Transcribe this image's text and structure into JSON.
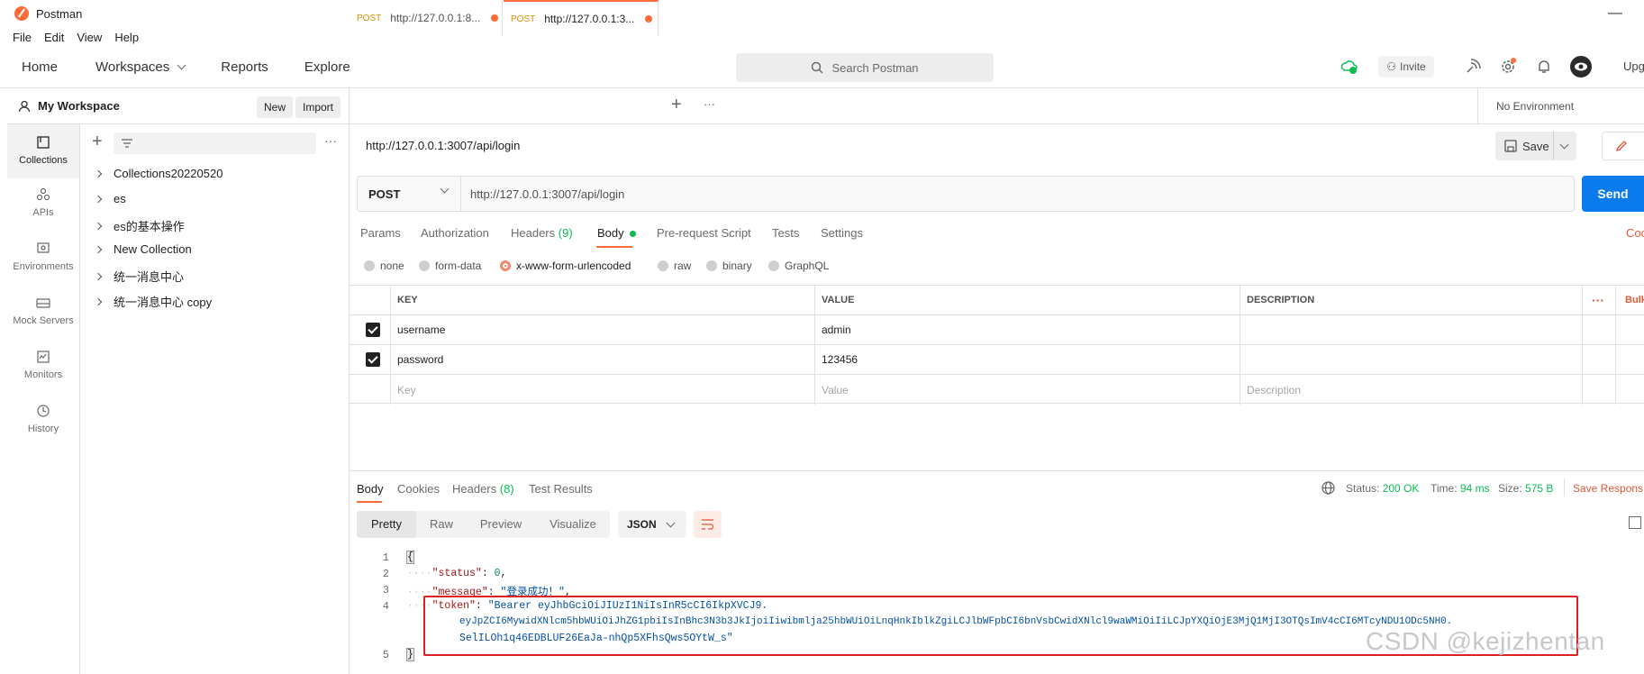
{
  "window": {
    "title": "Postman"
  },
  "menu": [
    "File",
    "Edit",
    "View",
    "Help"
  ],
  "header": {
    "nav": [
      "Home",
      "Workspaces",
      "Reports",
      "Explore"
    ],
    "search_placeholder": "Search Postman",
    "invite_label": "Invite",
    "upgrade_label": "Upg"
  },
  "workspace": {
    "name": "My Workspace",
    "new_label": "New",
    "import_label": "Import"
  },
  "rail": [
    {
      "label": "Collections",
      "icon": "collections-icon"
    },
    {
      "label": "APIs",
      "icon": "apis-icon"
    },
    {
      "label": "Environments",
      "icon": "environments-icon"
    },
    {
      "label": "Mock Servers",
      "icon": "mock-servers-icon"
    },
    {
      "label": "Monitors",
      "icon": "monitors-icon"
    },
    {
      "label": "History",
      "icon": "history-icon"
    }
  ],
  "collections": [
    "Collections20220520",
    "es",
    "es的基本操作",
    "New Collection",
    "统一消息中心",
    "统一消息中心 copy"
  ],
  "tabs": [
    {
      "method": "POST",
      "url": "http://127.0.0.1:8..."
    },
    {
      "method": "POST",
      "url": "http://127.0.0.1:3..."
    }
  ],
  "environment": "No Environment",
  "request": {
    "title": "http://127.0.0.1:3007/api/login",
    "method": "POST",
    "url": "http://127.0.0.1:3007/api/login",
    "save_label": "Save",
    "send_label": "Send",
    "code_label": "Coo"
  },
  "request_tabs": {
    "params": "Params",
    "authorization": "Authorization",
    "headers": "Headers",
    "headers_count": "(9)",
    "body": "Body",
    "prerequest": "Pre-request Script",
    "tests": "Tests",
    "settings": "Settings"
  },
  "body_types": [
    "none",
    "form-data",
    "x-www-form-urlencoded",
    "raw",
    "binary",
    "GraphQL"
  ],
  "body_type_selected": "x-www-form-urlencoded",
  "table": {
    "headers": [
      "KEY",
      "VALUE",
      "DESCRIPTION"
    ],
    "bulk_label": "Bulk",
    "rows": [
      {
        "key": "username",
        "value": "admin",
        "checked": true
      },
      {
        "key": "password",
        "value": "123456",
        "checked": true
      }
    ],
    "placeholder": {
      "key": "Key",
      "value": "Value",
      "description": "Description"
    }
  },
  "response": {
    "tabs": {
      "body": "Body",
      "cookies": "Cookies",
      "headers": "Headers",
      "headers_count": "(8)",
      "tests": "Test Results"
    },
    "status_label": "Status:",
    "status": "200 OK",
    "time_label": "Time:",
    "time": "94 ms",
    "size_label": "Size:",
    "size": "575 B",
    "save_label": "Save Respons",
    "views": [
      "Pretty",
      "Raw",
      "Preview",
      "Visualize"
    ],
    "format": "JSON",
    "code": {
      "line1": "{",
      "status_key": "\"status\"",
      "status_val": "0",
      "message_key": "\"message\"",
      "message_val": "\"登录成功！\"",
      "token_key": "\"token\"",
      "token_val_1": "\"Bearer eyJhbGciOiJIUzI1NiIsInR5cCI6IkpXVCJ9.",
      "token_val_2": "eyJpZCI6MywidXNlcm5hbWUiOiJhZG1pbiIsInBhc3N3b3JkIjoiIiwibmlja25hbWUiOiLnqHnkIblkZgiLCJlbWFpbCI6bnVsbCwidXNlcl9waWMiOiIiLCJpYXQiOjE3MjQ1MjI3OTQsImV4cCI6MTcyNDU1ODc5NH0.",
      "token_val_3": "SelILOh1q46EDBLUF26EaJa-nhQp5XFhsQws5OYtW_s\"",
      "line5": "}"
    }
  },
  "watermark": "CSDN @kejizhentan"
}
